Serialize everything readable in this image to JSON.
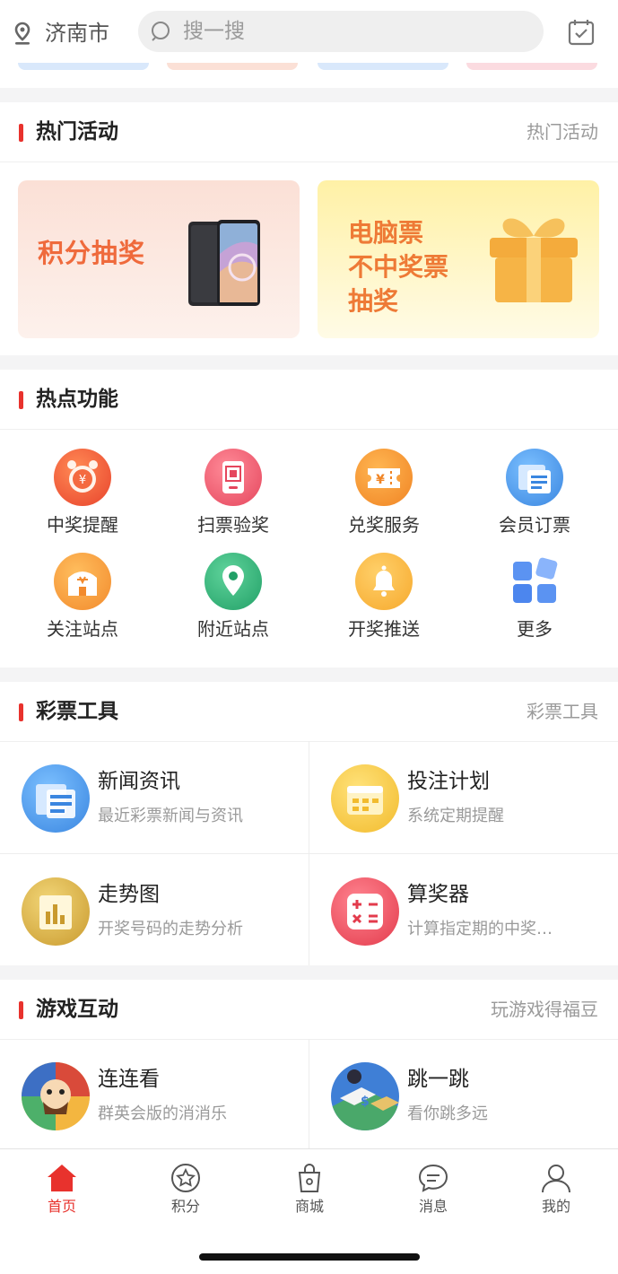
{
  "header": {
    "location": "济南市",
    "search_placeholder": "搜一搜",
    "icons": {
      "location": "location-pin-icon",
      "search": "search-icon",
      "checkin": "calendar-check-icon"
    }
  },
  "hot_activities": {
    "title": "热门活动",
    "more": "热门活动",
    "banners": [
      {
        "text": "积分抽奖",
        "image": "smartphone-image"
      },
      {
        "lines": [
          "电脑票",
          "不中奖票",
          "抽奖"
        ],
        "image": "gift-box-image"
      }
    ]
  },
  "hot_features": {
    "title": "热点功能",
    "items": [
      {
        "label": "中奖提醒",
        "icon": "alarm-clock-icon",
        "color": "#f0553a"
      },
      {
        "label": "扫票验奖",
        "icon": "scan-ticket-icon",
        "color": "#ee5a6e"
      },
      {
        "label": "兑奖服务",
        "icon": "ticket-exchange-icon",
        "color": "#f5962a"
      },
      {
        "label": "会员订票",
        "icon": "membership-ticket-icon",
        "color": "#4a9be8"
      },
      {
        "label": "关注站点",
        "icon": "store-icon",
        "color": "#f59a33"
      },
      {
        "label": "附近站点",
        "icon": "map-pin-icon",
        "color": "#2fb27a"
      },
      {
        "label": "开奖推送",
        "icon": "bell-icon",
        "color": "#f7b23d"
      },
      {
        "label": "更多",
        "icon": "grid-icon",
        "color": "#5b93f2"
      }
    ]
  },
  "lottery_tools": {
    "title": "彩票工具",
    "more": "彩票工具",
    "items": [
      {
        "title": "新闻资讯",
        "subtitle": "最近彩票新闻与资讯",
        "icon": "newspaper-icon",
        "color": "#4a9be8"
      },
      {
        "title": "投注计划",
        "subtitle": "系统定期提醒",
        "icon": "calendar-plan-icon",
        "color": "#f5c53a"
      },
      {
        "title": "走势图",
        "subtitle": "开奖号码的走势分析",
        "icon": "bar-chart-icon",
        "color": "#d8b040"
      },
      {
        "title": "算奖器",
        "subtitle": "计算指定期的中奖…",
        "icon": "calculator-icon",
        "color": "#ee4d5b"
      }
    ]
  },
  "games": {
    "title": "游戏互动",
    "more": "玩游戏得福豆",
    "items": [
      {
        "title": "连连看",
        "subtitle": "群英会版的消消乐",
        "icon": "link-game-avatar"
      },
      {
        "title": "跳一跳",
        "subtitle": "看你跳多远",
        "icon": "jump-game-avatar"
      }
    ]
  },
  "tabbar": {
    "active_color": "#e8322d",
    "items": [
      {
        "label": "首页",
        "icon": "home-icon",
        "active": true
      },
      {
        "label": "积分",
        "icon": "star-badge-icon",
        "active": false
      },
      {
        "label": "商城",
        "icon": "shopping-bag-icon",
        "active": false
      },
      {
        "label": "消息",
        "icon": "message-icon",
        "active": false
      },
      {
        "label": "我的",
        "icon": "user-icon",
        "active": false
      }
    ]
  }
}
